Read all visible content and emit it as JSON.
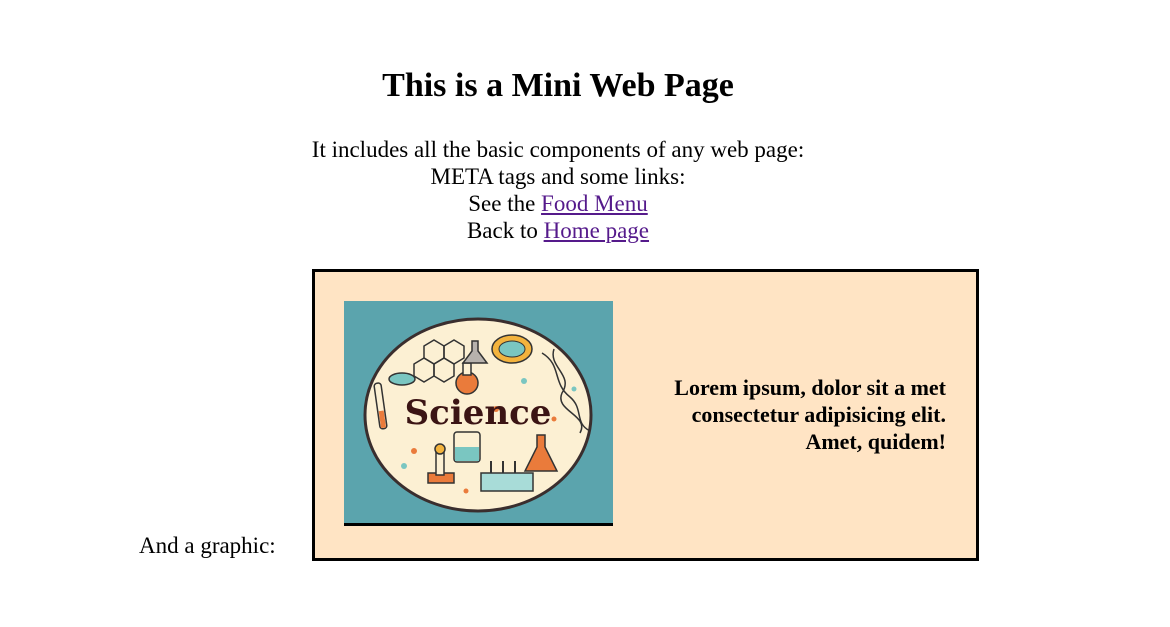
{
  "page": {
    "title": "This is a Mini Web Page",
    "intro_line": "It includes all the basic components of any web page:",
    "meta_line": "META tags and some links:",
    "food_prefix": "See the",
    "food_link": "Food Menu",
    "home_prefix": "Back to",
    "home_link": "Home page",
    "graphic_label": "And a graphic:"
  },
  "box": {
    "image_text": "Science",
    "lorem_line1": "Lorem ipsum, dolor sit a met",
    "lorem_line2": "consectetur adipisicing elit.",
    "lorem_line3": "Amet, quidem!"
  },
  "colors": {
    "box_background": "#ffe4c4",
    "image_background": "#5ba4ad",
    "link": "#551a8b"
  }
}
